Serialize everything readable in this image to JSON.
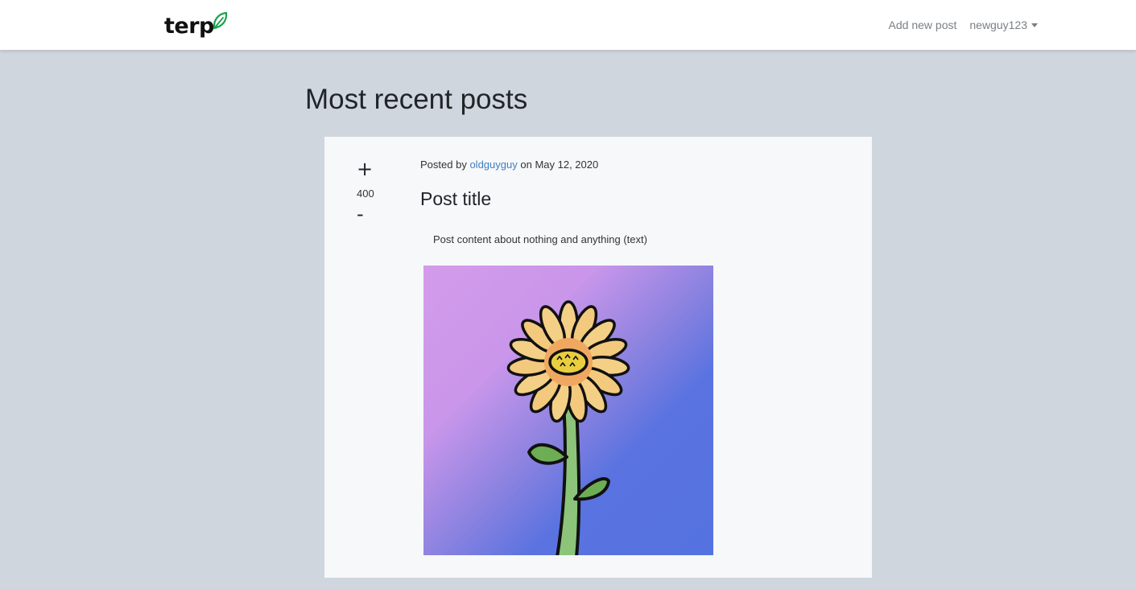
{
  "nav": {
    "brand": "terp",
    "add_post_label": "Add new post",
    "username": "newguy123",
    "brand_leaf_color": "#1aa34a"
  },
  "page": {
    "title": "Most recent posts"
  },
  "post": {
    "votes": "400",
    "upvote_label": "+",
    "downvote_label": "-",
    "meta_prefix": "Posted by",
    "author": "oldguyguy",
    "meta_on": "on",
    "date": "May 12, 2020",
    "title": "Post title",
    "content": "Post content about nothing and anything (text)",
    "image": "flower-illustration"
  },
  "colors": {
    "background": "#d0d6dd",
    "card": "#f7f8fa",
    "link": "#3e7fc1"
  }
}
